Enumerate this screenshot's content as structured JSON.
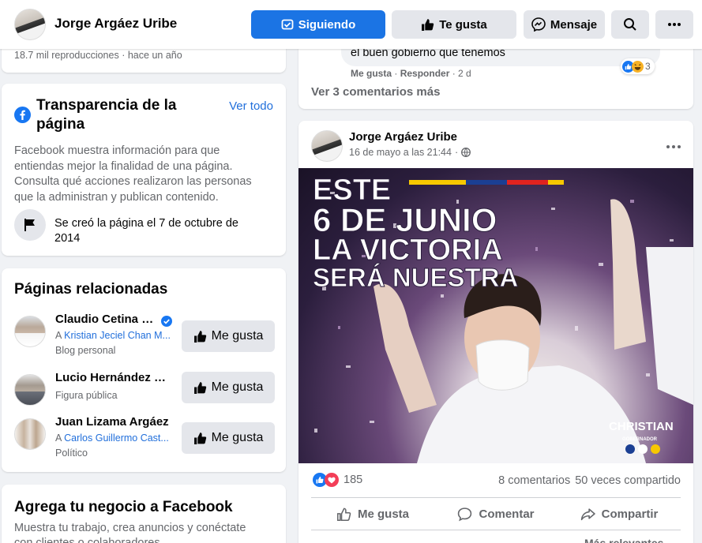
{
  "header": {
    "page_name": "Jorge Argáez Uribe",
    "following_label": "Siguiendo",
    "like_label": "Te gusta",
    "message_label": "Mensaje"
  },
  "video_meta": {
    "views": "18.7 mil reproducciones",
    "separator": "·",
    "age": "hace un año"
  },
  "transparency": {
    "title_line1": "Transparencia de la",
    "title_line2": "página",
    "see_all": "Ver todo",
    "desc_lines": [
      "Facebook muestra información para que",
      "entiendas mejor la finalidad de una página.",
      "Consulta qué acciones realizaron las personas",
      "que la administran y publican contenido."
    ],
    "created_line1": "Se creó la página el 7 de octubre de",
    "created_line2": "2014"
  },
  "related": {
    "title": "Páginas relacionadas",
    "like_label": "Me gusta",
    "items": [
      {
        "name": "Claudio Cetina G...",
        "prefix": "A",
        "friend": "Kristian Jeciel Chan M...",
        "category": "Blog personal",
        "verified": true
      },
      {
        "name": "Lucio Hernández G...",
        "category": "Figura pública"
      },
      {
        "name": "Juan Lizama Argáez",
        "prefix": "A",
        "friend": "Carlos Guillermo Cast...",
        "category": "Político"
      }
    ]
  },
  "business": {
    "title": "Agrega tu negocio a Facebook",
    "desc_line1": "Muestra tu trabajo, crea anuncios y conéctate",
    "desc_line2": "con clientes o colaboradores."
  },
  "prev_post": {
    "comment_text": "el buen gobierno que tenemos",
    "like": "Me gusta",
    "reply": "Responder",
    "time": "2 d",
    "reaction_count": "3",
    "more_comments": "Ver 3 comentarios más"
  },
  "post": {
    "author": "Jorge Argáez Uribe",
    "date": "16 de mayo a las 21:44",
    "date_sep": "·",
    "image_text": [
      "ESTE",
      "6 DE JUNIO",
      "LA VICTORIA",
      "SERÁ NUESTRA"
    ],
    "image_brand": "CHRISTIAN",
    "image_brand_sub": "GOBERNADOR",
    "reactions_count": "185",
    "comments_count": "8 comentarios",
    "shares_count": "50 veces compartido",
    "like_label": "Me gusta",
    "comment_label": "Comentar",
    "share_label": "Compartir",
    "sort_label": "Más relevantes"
  },
  "colors": {
    "primary_blue": "#1b74e4",
    "link_blue": "#216fdb",
    "background": "#f0f2f5"
  }
}
